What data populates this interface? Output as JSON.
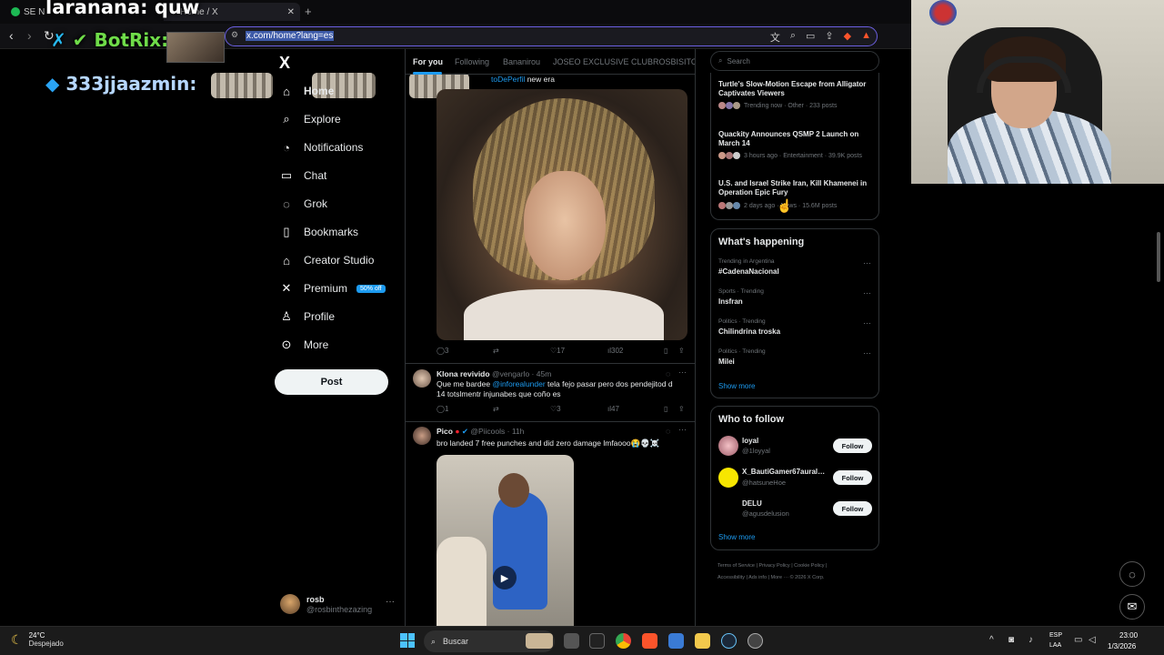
{
  "browser": {
    "tab1_label": "SE N",
    "tab2_label": "Home / X",
    "url": "x.com/home?lang=es"
  },
  "overlay": {
    "top_text": "laranana: quw",
    "botrix_label": "BotRix:",
    "jazmin_label": "333jjaazmin:"
  },
  "nav": {
    "logo": "X",
    "items": [
      {
        "label": "Home",
        "icon": "home-icon"
      },
      {
        "label": "Explore",
        "icon": "search-icon"
      },
      {
        "label": "Notifications",
        "icon": "bell-icon"
      },
      {
        "label": "Chat",
        "icon": "chat-icon"
      },
      {
        "label": "Grok",
        "icon": "grok-icon"
      },
      {
        "label": "Bookmarks",
        "icon": "bookmark-icon"
      },
      {
        "label": "Creator Studio",
        "icon": "creator-icon"
      },
      {
        "label": "Premium",
        "icon": "x-icon"
      },
      {
        "label": "Profile",
        "icon": "person-icon"
      },
      {
        "label": "More",
        "icon": "more-circle-icon"
      }
    ],
    "premium_badge": "50% off",
    "post_button": "Post",
    "account": {
      "name": "rosb",
      "handle": "@rosbinthezazing"
    }
  },
  "feed": {
    "tabs": [
      "For you",
      "Following",
      "Bananirou",
      "JOSEO EXCLUSIVE CLUB",
      "ROSBISITOS"
    ],
    "tweet1": {
      "mention": "toDePerfil",
      "text": "new era",
      "replies": "3",
      "likes": "17",
      "views": "302"
    },
    "tweet2": {
      "name": "Klona revivido",
      "handle": "@vengarlo",
      "time": "45m",
      "text_a": "Que me bardee ",
      "mention": "@inforealunder",
      "text_b": " tela fejo pasar pero dos pendejitod d 14 totslmentr injunabes que coño es",
      "replies": "1",
      "likes": "3",
      "views": "47"
    },
    "tweet3": {
      "name": "Pico",
      "handle": "@Piicools",
      "time": "11h",
      "text": "bro landed 7 free punches and did zero damage lmfaooo😭💀☠️"
    }
  },
  "right": {
    "search_placeholder": "Search",
    "news": [
      {
        "title": "Turtle's Slow-Motion Escape from Alligator Captivates Viewers",
        "meta": "Trending now · Other · 233 posts"
      },
      {
        "title": "Quackity Announces QSMP 2 Launch on March 14",
        "meta": "3 hours ago · Entertainment · 39.9K posts"
      },
      {
        "title": "U.S. and Israel Strike Iran, Kill Khamenei in Operation Epic Fury",
        "meta": "2 days ago · News · 15.6M posts"
      }
    ],
    "happening_title": "What's happening",
    "trends": [
      {
        "meta": "Trending in Argentina",
        "name": "#CadenaNacional"
      },
      {
        "meta": "Sports · Trending",
        "name": "Insfran"
      },
      {
        "meta": "Politics · Trending",
        "name": "Chilindrina troska"
      },
      {
        "meta": "Politics · Trending",
        "name": "Milei"
      }
    ],
    "show_more": "Show more",
    "who_title": "Who to follow",
    "follow": [
      {
        "name": "loyal",
        "handle": "@1loyyal",
        "button": "Follow"
      },
      {
        "name": "X_BautiGamer67auralegend",
        "handle": "@hatsuneHoe",
        "button": "Follow"
      },
      {
        "name": "DELU",
        "handle": "@agusdelusion",
        "button": "Follow"
      }
    ],
    "footer_line1": "Terms of Service  |  Privacy Policy  |  Cookie Policy  |",
    "footer_line2": "Accessibility  |  Ads info  |  More ···  © 2026 X Corp."
  },
  "taskbar": {
    "temp": "24°C",
    "weather": "Despejado",
    "search": "Buscar",
    "lang1": "ESP",
    "lang2": "LAA",
    "time": "23:00",
    "date": "1/3/2026"
  },
  "colors": {
    "accent": "#1d9bf0",
    "url_border": "#6b5fe0",
    "brave": "#fb542b"
  }
}
